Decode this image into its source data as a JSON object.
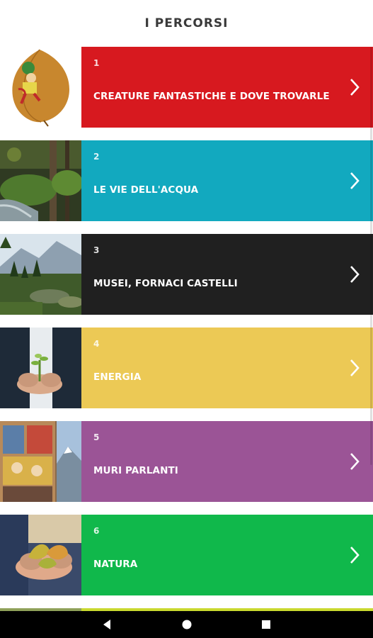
{
  "header": {
    "title": "I PERCORSI"
  },
  "routes": [
    {
      "number": "1",
      "label": "CREATURE FANTASTICHE E DOVE TROVARLE",
      "color": "#d7191f",
      "thumb": "leaf-elf-drawing"
    },
    {
      "number": "2",
      "label": "LE VIE DELL'ACQUA",
      "color": "#12a9bf",
      "thumb": "forest-stream-photo"
    },
    {
      "number": "3",
      "label": "MUSEI, FORNACI CASTELLI",
      "color": "#202020",
      "thumb": "mountain-valley-photo"
    },
    {
      "number": "4",
      "label": "ENERGIA",
      "color": "#ecc955",
      "thumb": "hands-holding-seedling-photo"
    },
    {
      "number": "5",
      "label": "MURI PARLANTI",
      "color": "#9b5496",
      "thumb": "painted-wall-mural-photo"
    },
    {
      "number": "6",
      "label": "NATURA",
      "color": "#10b84b",
      "thumb": "hands-holding-leaves-photo"
    }
  ],
  "icons": {
    "chevron": "chevron-right-icon",
    "back": "back-triangle-icon",
    "home": "home-circle-icon",
    "recents": "recents-square-icon"
  }
}
